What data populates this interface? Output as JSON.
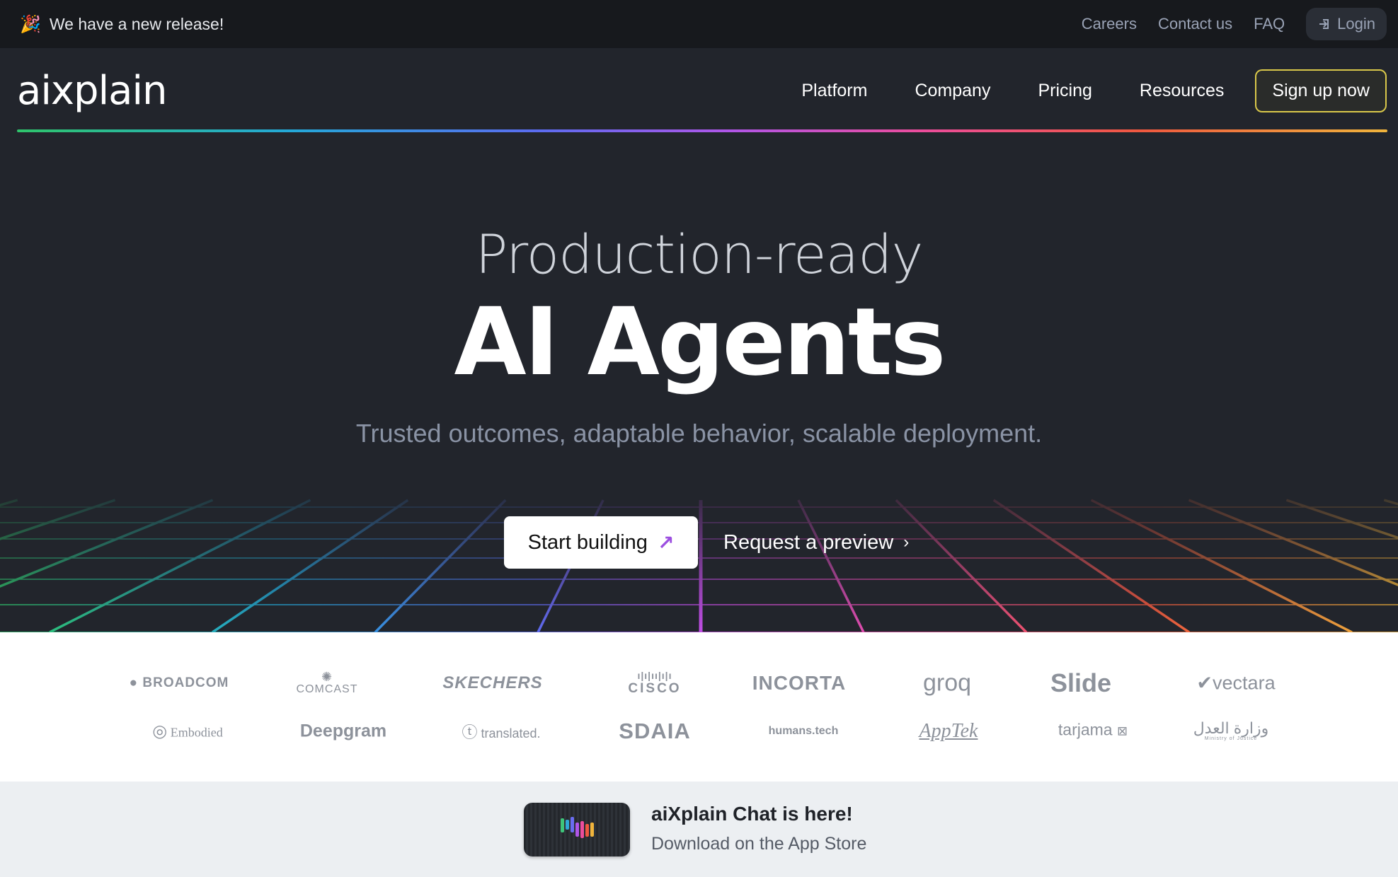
{
  "announcement": {
    "emoji": "🎉",
    "text": "We have a new release!"
  },
  "top_links": [
    "Careers",
    "Contact us",
    "FAQ"
  ],
  "login_label": "Login",
  "nav": {
    "logo": "aixplain",
    "items": [
      "Platform",
      "Company",
      "Pricing",
      "Resources"
    ],
    "signup": "Sign up now"
  },
  "hero": {
    "pre_title": "Production-ready",
    "title": "AI Agents",
    "subtitle": "Trusted outcomes, adaptable behavior, scalable deployment.",
    "primary_cta": "Start building",
    "secondary_cta": "Request a preview"
  },
  "client_logos": {
    "row1": [
      "BROADCOM",
      "COMCAST",
      "SKECHERS",
      "CISCO",
      "INCORTA",
      "groq",
      "Slide",
      "vectara"
    ],
    "row2": [
      "Embodied",
      "Deepgram",
      "translated.",
      "SDAIA",
      "humans.tech",
      "AppTek",
      "tarjama",
      "وزارة العدل"
    ],
    "ministry_caption": "Ministry of Justice"
  },
  "promo": {
    "title": "aiXplain Chat is here!",
    "subtitle": "Download on the App Store"
  },
  "colors": {
    "accent_border": "#d9c84a",
    "cta_arrow": "#9c4fe0",
    "background": "#22252c"
  },
  "icons": {
    "announcement": "party-popper-icon",
    "login": "login-arrow-icon",
    "cta_primary": "arrow-up-right-icon",
    "cta_secondary": "chevron-right-icon"
  }
}
